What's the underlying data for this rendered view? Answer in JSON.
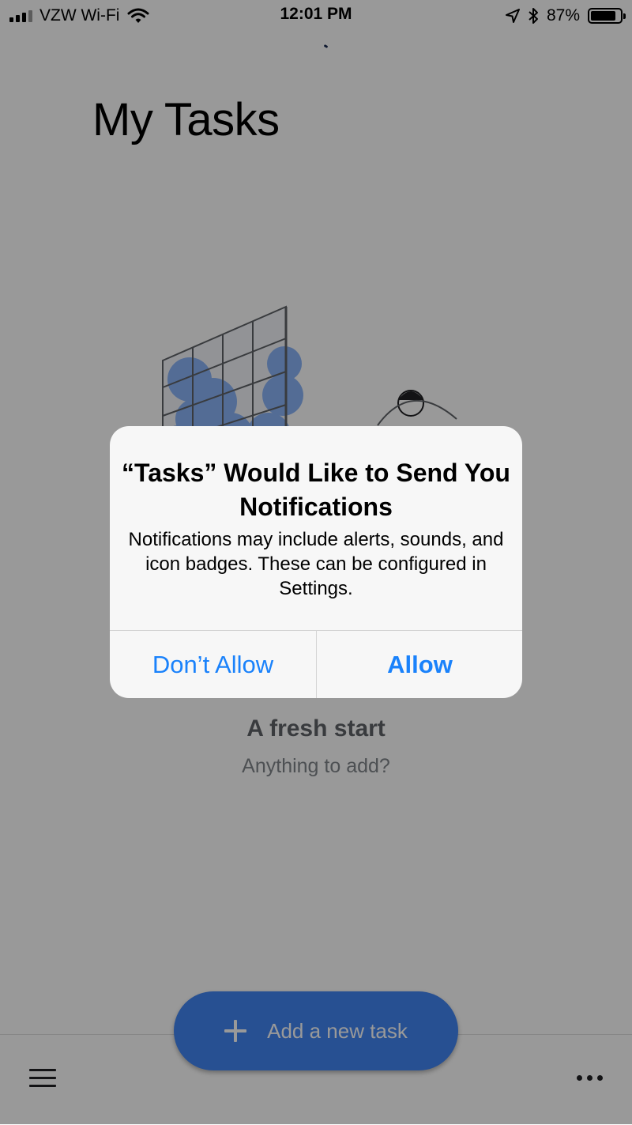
{
  "status_bar": {
    "carrier": "VZW Wi-Fi",
    "time": "12:01 PM",
    "battery_percent": "87%",
    "battery_level": 0.87,
    "icons": [
      "signal-bars-icon",
      "wifi-icon",
      "location-arrow-icon",
      "bluetooth-icon",
      "battery-icon"
    ]
  },
  "page": {
    "title": "My Tasks"
  },
  "empty_state": {
    "title": "A fresh start",
    "subtitle": "Anything to add?",
    "illustration": "window-and-person-illustration"
  },
  "fab": {
    "label": "Add a new task",
    "icon": "plus-icon",
    "color": "#4285f4"
  },
  "bottom_bar": {
    "menu_icon": "hamburger-menu-icon",
    "more_icon": "more-horizontal-icon"
  },
  "alert": {
    "title": "“Tasks” Would Like to Send You Notifications",
    "message": "Notifications may include alerts, sounds, and icon badges. These can be configured in Settings.",
    "buttons": {
      "deny": "Don’t Allow",
      "allow": "Allow"
    },
    "button_color": "#1a82fb"
  }
}
